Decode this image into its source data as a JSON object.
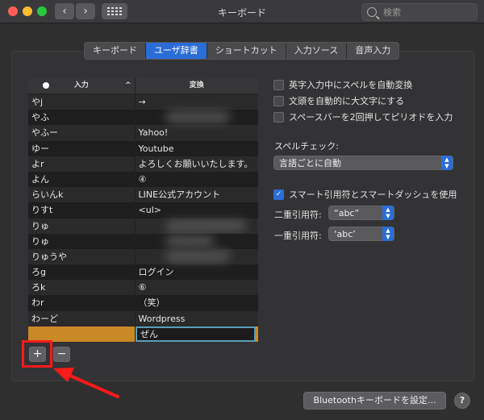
{
  "window": {
    "title": "キーボード"
  },
  "search": {
    "placeholder": "検索"
  },
  "tabs": [
    {
      "label": "キーボード",
      "active": false
    },
    {
      "label": "ユーザ辞書",
      "active": true
    },
    {
      "label": "ショートカット",
      "active": false
    },
    {
      "label": "入力ソース",
      "active": false
    },
    {
      "label": "音声入力",
      "active": false
    }
  ],
  "table": {
    "headers": {
      "input": "入力",
      "output": "変換"
    },
    "rows": [
      {
        "input": "やj",
        "output": "→"
      },
      {
        "input": "やふ",
        "output": "",
        "blurred": true
      },
      {
        "input": "やふー",
        "output": "Yahoo!"
      },
      {
        "input": "ゆー",
        "output": "Youtube"
      },
      {
        "input": "よr",
        "output": "よろしくお願いいたします。"
      },
      {
        "input": "よん",
        "output": "④"
      },
      {
        "input": "らいんk",
        "output": "LINE公式アカウント"
      },
      {
        "input": "りすt",
        "output": "<ul>"
      },
      {
        "input": "りゅ",
        "output": "",
        "blurred": true
      },
      {
        "input": "りゅ",
        "output": "",
        "blurred": true
      },
      {
        "input": "りゅうや",
        "output": "",
        "blurred": true
      },
      {
        "input": "ろg",
        "output": "ログイン"
      },
      {
        "input": "ろk",
        "output": "⑥"
      },
      {
        "input": "わr",
        "output": "（笑）"
      },
      {
        "input": "わーど",
        "output": "Wordpress"
      },
      {
        "input": "",
        "output": "ぜん",
        "editing": true
      }
    ]
  },
  "buttons": {
    "add": "+",
    "remove": "−",
    "bluetooth": "Bluetoothキーボードを設定...",
    "help": "?"
  },
  "options": {
    "auto_correct": {
      "label": "英字入力中にスペルを自動変換",
      "checked": false
    },
    "auto_capitalize": {
      "label": "文頭を自動的に大文字にする",
      "checked": false
    },
    "double_space_period": {
      "label": "スペースバーを2回押してピリオドを入力",
      "checked": false
    },
    "spell_check_label": "スペルチェック:",
    "spell_check_value": "言語ごとに自動",
    "smart_quotes": {
      "label": "スマート引用符とスマートダッシュを使用",
      "checked": true
    },
    "double_quote_label": "二重引用符:",
    "double_quote_value": "“abc”",
    "single_quote_label": "一重引用符:",
    "single_quote_value": "‘abc’"
  },
  "colors": {
    "accent": "#2b6dd6",
    "highlight": "#ff1a1a",
    "editing_row": "#c98a25"
  }
}
